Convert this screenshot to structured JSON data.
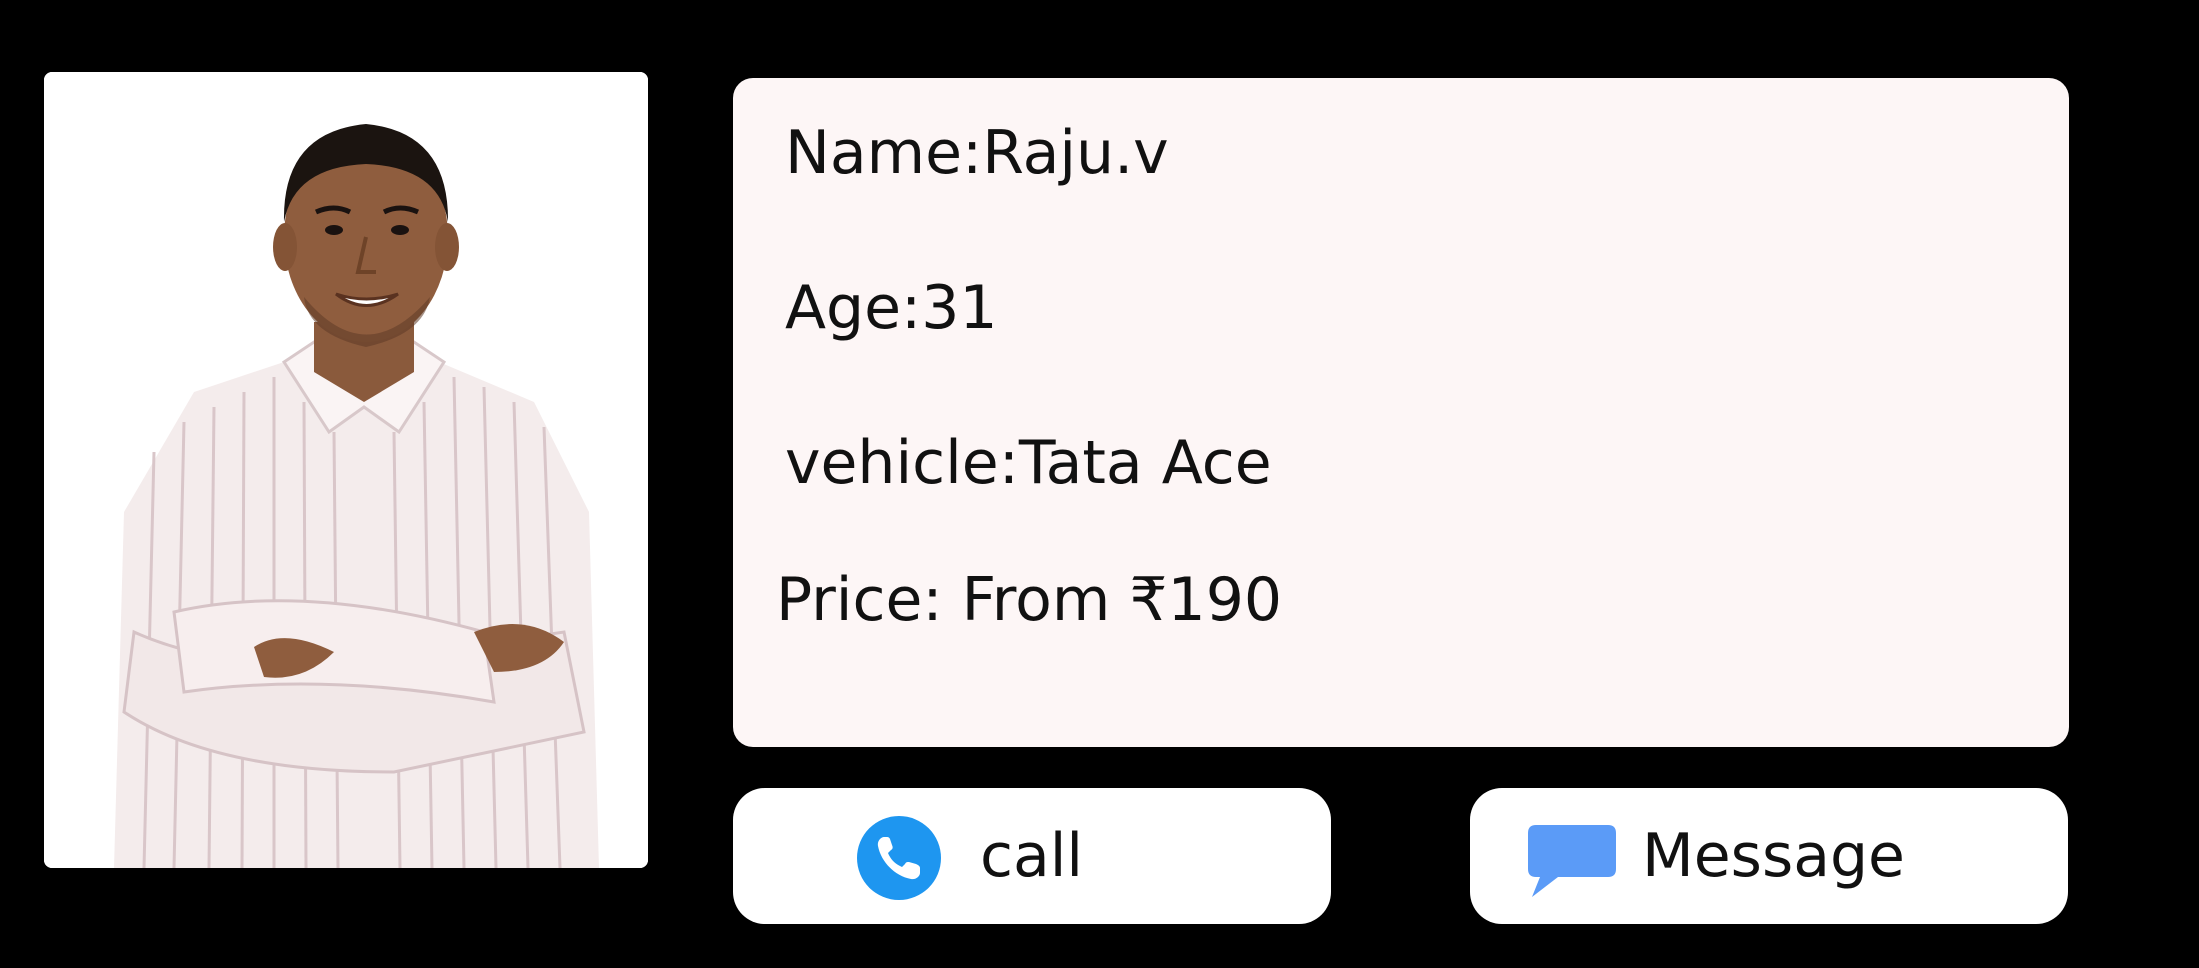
{
  "profile": {
    "photo_alt": "Raju.v",
    "name_label": "Name:Raju.v",
    "age_label": "Age:31",
    "vehicle_label": "vehicle:Tata Ace",
    "price_label": "Price: From ₹190"
  },
  "actions": {
    "call_label": "call",
    "call_icon": "phone-icon",
    "message_label": "Message",
    "message_icon": "chat-bubble-icon"
  },
  "colors": {
    "background": "#000000",
    "info_card": "#fdf6f6",
    "call_icon": "#1e96f0",
    "message_icon": "#5b9bf7"
  }
}
